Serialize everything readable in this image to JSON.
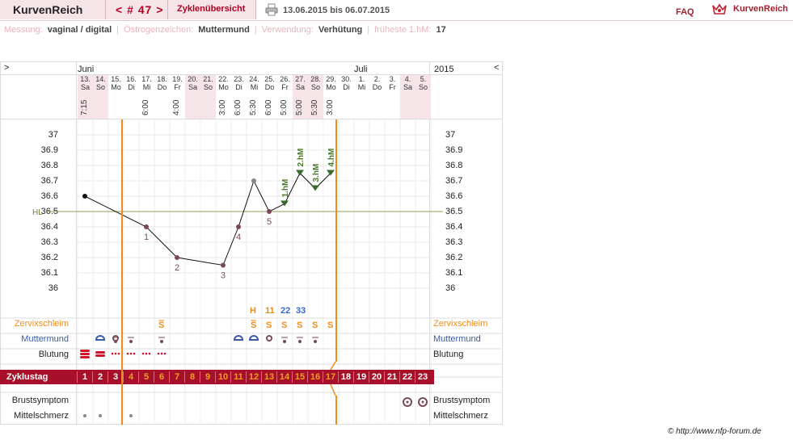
{
  "header": {
    "brand": "KurvenReich",
    "cycle_nav": "< # 47 >",
    "overview": "Zyklenübersicht",
    "date_range": "13.06.2015 bis 06.07.2015",
    "faq": "FAQ",
    "logo_text": "KurvenReich"
  },
  "settings": {
    "messung_label": "Messung:",
    "messung_value": "vaginal / digital",
    "oestrogen_label": "Östrogenzeichen:",
    "oestrogen_value": "Muttermund",
    "verwendung_label": "Verwendung:",
    "verwendung_value": "Verhütung",
    "frueheste_label": "früheste 1.hM:",
    "frueheste_value": "17"
  },
  "chart": {
    "nav_left": ">",
    "nav_right": "<",
    "month1": "Juni",
    "month2": "Juli",
    "year": "2015",
    "hl_label": "HL",
    "row_labels": {
      "zervix": "Zervixschleim",
      "muttermund": "Muttermund",
      "blutung": "Blutung",
      "zyklustag": "Zyklustag",
      "brust": "Brustsymptom",
      "mittel": "Mittelschmerz"
    },
    "colors": {
      "accent": "#a8102a",
      "temp_line": "#000000",
      "hl_line": "#8aa050",
      "orange": "#f08c1a",
      "green": "#4a7a2a"
    }
  },
  "chart_data": {
    "type": "line",
    "title": "",
    "ylim": [
      36.0,
      37.0
    ],
    "y_ticks": [
      "37",
      "36.9",
      "36.8",
      "36.7",
      "36.6",
      "36.5",
      "36.4",
      "36.3",
      "36.2",
      "36.1",
      "36"
    ],
    "days": [
      {
        "d": "13.",
        "w": "Sa",
        "t": "7:15",
        "z": "1",
        "temp": 36.6
      },
      {
        "d": "14.",
        "w": "So",
        "t": "",
        "z": "2",
        "temp": null
      },
      {
        "d": "15.",
        "w": "Mo",
        "t": "",
        "z": "3",
        "temp": null
      },
      {
        "d": "16.",
        "w": "Di",
        "t": "",
        "z": "4",
        "temp": null
      },
      {
        "d": "17.",
        "w": "Mi",
        "t": "6:00",
        "z": "5",
        "temp": 36.4
      },
      {
        "d": "18.",
        "w": "Do",
        "t": "",
        "z": "6",
        "temp": null
      },
      {
        "d": "19.",
        "w": "Fr",
        "t": "4:00",
        "z": "7",
        "temp": 36.2
      },
      {
        "d": "20.",
        "w": "Sa",
        "t": "",
        "z": "8",
        "temp": null
      },
      {
        "d": "21.",
        "w": "So",
        "t": "",
        "z": "9",
        "temp": null
      },
      {
        "d": "22.",
        "w": "Mo",
        "t": "3:00",
        "z": "10",
        "temp": 36.15
      },
      {
        "d": "23.",
        "w": "Di",
        "t": "6:00",
        "z": "11",
        "temp": 36.4
      },
      {
        "d": "24.",
        "w": "Mi",
        "t": "5:30",
        "z": "12",
        "temp": 36.7
      },
      {
        "d": "25.",
        "w": "Do",
        "t": "6:00",
        "z": "13",
        "temp": 36.5
      },
      {
        "d": "26.",
        "w": "Fr",
        "t": "5:00",
        "z": "14",
        "temp": 36.55
      },
      {
        "d": "27.",
        "w": "Sa",
        "t": "5:00",
        "z": "15",
        "temp": 36.75
      },
      {
        "d": "28.",
        "w": "So",
        "t": "5:30",
        "z": "16",
        "temp": 36.65
      },
      {
        "d": "29.",
        "w": "Mo",
        "t": "3:00",
        "z": "17",
        "temp": 36.75
      },
      {
        "d": "30.",
        "w": "Di",
        "t": "",
        "z": "18",
        "temp": null
      },
      {
        "d": "1.",
        "w": "Mi",
        "t": "",
        "z": "19",
        "temp": null
      },
      {
        "d": "2.",
        "w": "Do",
        "t": "",
        "z": "20",
        "temp": null
      },
      {
        "d": "3.",
        "w": "Fr",
        "t": "",
        "z": "21",
        "temp": null
      },
      {
        "d": "4.",
        "w": "Sa",
        "t": "",
        "z": "22",
        "temp": null
      },
      {
        "d": "5.",
        "w": "So",
        "t": "",
        "z": "23",
        "temp": null
      }
    ],
    "low_labels": [
      "1",
      "2",
      "3",
      "4",
      "5"
    ],
    "hm_labels": [
      "1.hM",
      "2.hM",
      "3.hM",
      "4.hM"
    ],
    "hl_value": 36.5,
    "zervix_top": [
      "H",
      "11",
      "22",
      "33"
    ],
    "zervix_s": "S",
    "footer": "© http://www.nfp-forum.de"
  }
}
